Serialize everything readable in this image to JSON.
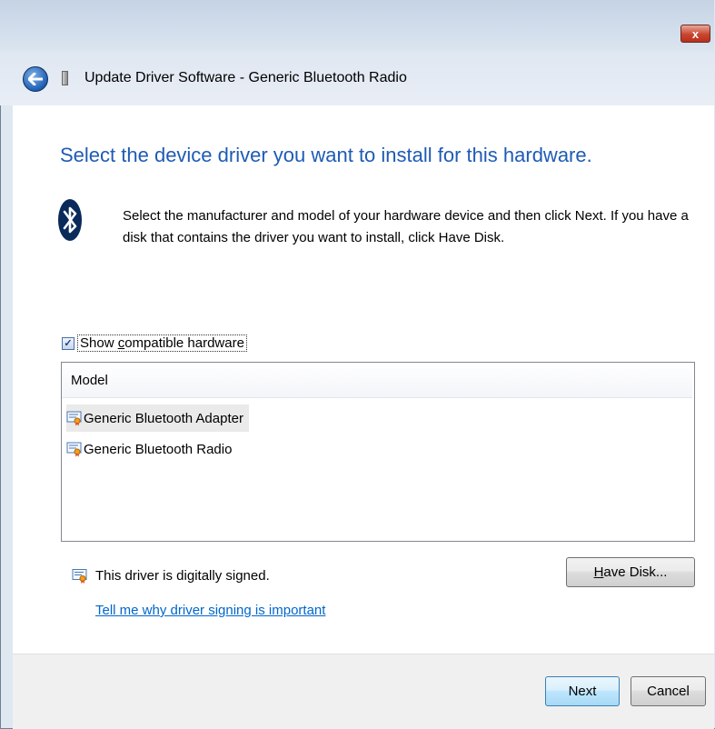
{
  "window": {
    "title": "Update Driver Software - Generic Bluetooth Radio",
    "close_label": "x"
  },
  "heading": "Select the device driver you want to install for this hardware.",
  "description": "Select the manufacturer and model of your hardware device and then click Next. If you have a disk that contains the driver you want to install, click Have Disk.",
  "compatible": {
    "checked": true,
    "label_prefix": "Show ",
    "label_accel": "c",
    "label_rest": "ompatible hardware"
  },
  "models": {
    "header": "Model",
    "items": [
      {
        "label": "Generic Bluetooth Adapter",
        "selected": true
      },
      {
        "label": "Generic Bluetooth Radio",
        "selected": false
      }
    ]
  },
  "signing": {
    "status": "This driver is digitally signed.",
    "link": "Tell me why driver signing is important"
  },
  "buttons": {
    "have_disk_accel": "H",
    "have_disk_rest": "ave Disk...",
    "next": "Next",
    "cancel": "Cancel"
  },
  "icons": {
    "back": "back-arrow-icon",
    "device": "device-icon",
    "bluetooth": "bluetooth-icon",
    "certificate": "certificate-icon"
  },
  "colors": {
    "heading": "#1e5bb5",
    "link": "#0066cc",
    "titlebar": "#c5d3e4",
    "footer": "#f0f0f0"
  }
}
